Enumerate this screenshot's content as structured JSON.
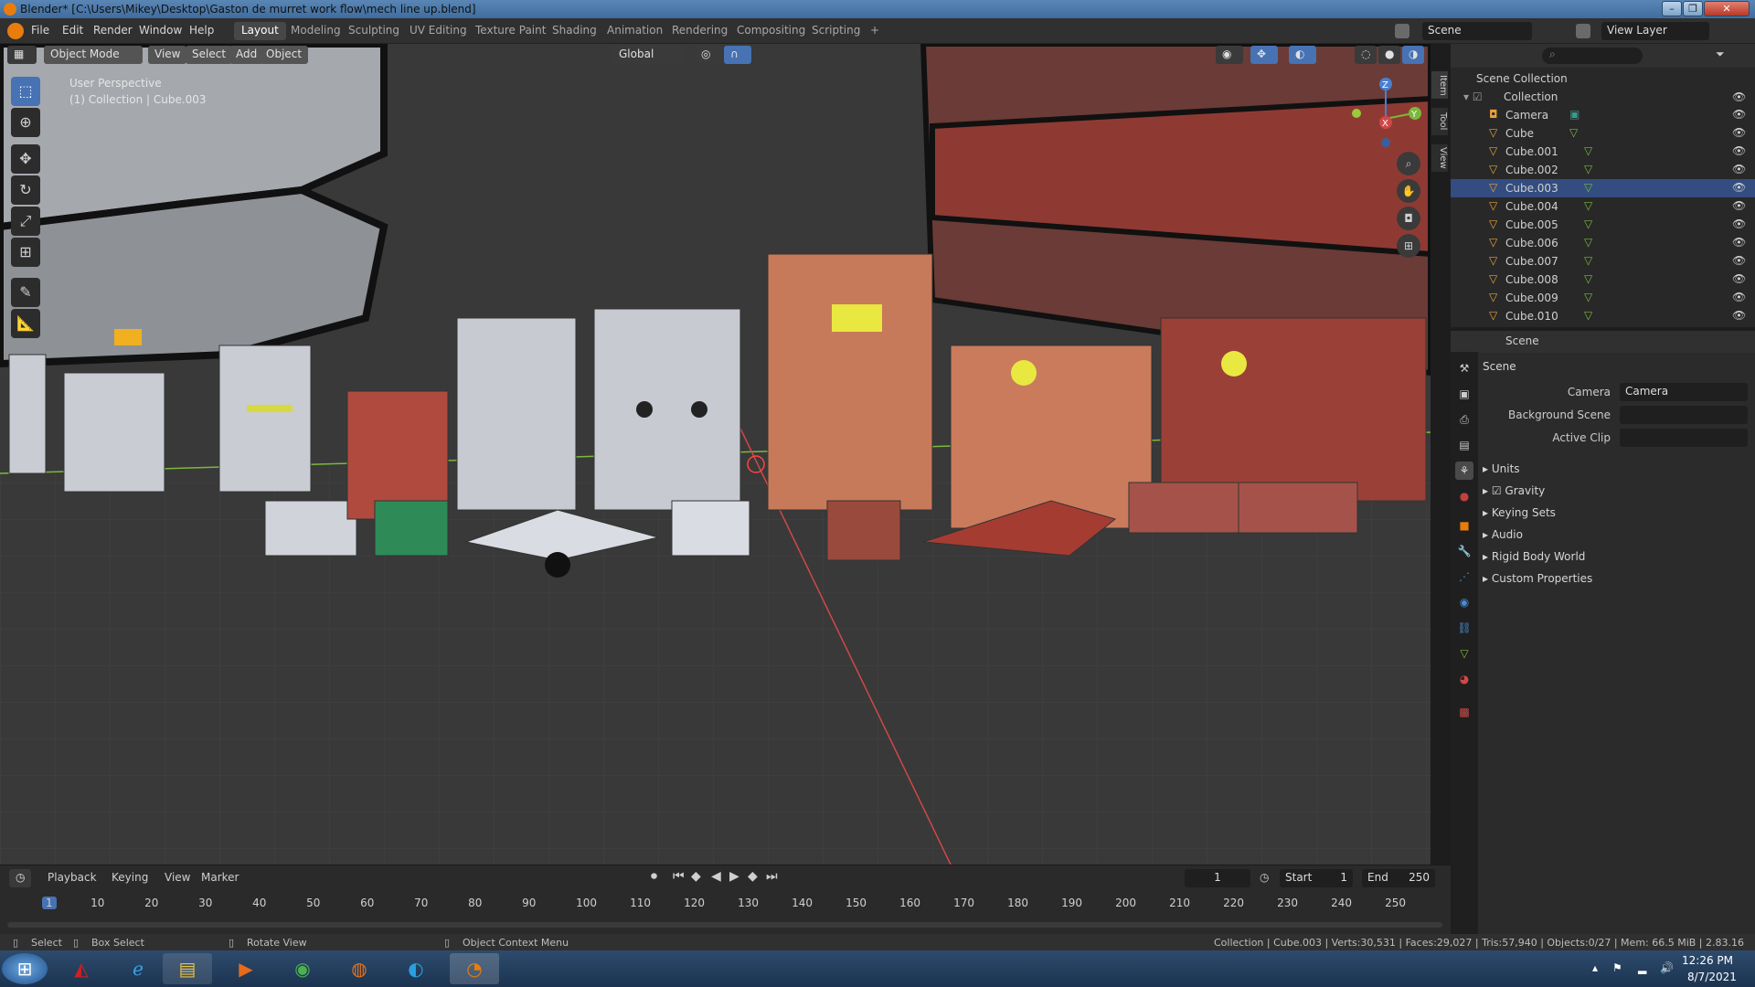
{
  "window": {
    "title": "Blender* [C:\\Users\\Mikey\\Desktop\\Gaston de murret work flow\\mech line up.blend]",
    "minimize": "–",
    "maximize": "❐",
    "close": "✕"
  },
  "menus": [
    "File",
    "Edit",
    "Render",
    "Window",
    "Help"
  ],
  "workspaces": [
    "Layout",
    "Modeling",
    "Sculpting",
    "UV Editing",
    "Texture Paint",
    "Shading",
    "Animation",
    "Rendering",
    "Compositing",
    "Scripting",
    "+"
  ],
  "scene_field": "Scene",
  "view_layer_field": "View Layer",
  "viewport": {
    "mode": "Object Mode",
    "view": "View",
    "select": "Select",
    "add": "Add",
    "object": "Object",
    "orientation": "Global",
    "overlay_line1": "User Perspective",
    "overlay_line2": "(1) Collection | Cube.003",
    "side_tabs": [
      "Item",
      "Tool",
      "View"
    ],
    "gizmo": {
      "x": "X",
      "y": "Y",
      "z": "Z"
    }
  },
  "outliner": {
    "root": "Scene Collection",
    "collection": "Collection",
    "items": [
      "Camera",
      "Cube",
      "Cube.001",
      "Cube.002",
      "Cube.003",
      "Cube.004",
      "Cube.005",
      "Cube.006",
      "Cube.007",
      "Cube.008",
      "Cube.009",
      "Cube.010"
    ],
    "selected": "Cube.003"
  },
  "properties": {
    "header": "Scene",
    "panel": "Scene",
    "camera_label": "Camera",
    "camera_value": "Camera",
    "bg_scene_label": "Background Scene",
    "active_clip_label": "Active Clip",
    "sections": [
      "Units",
      "Gravity",
      "Keying Sets",
      "Audio",
      "Rigid Body World",
      "Custom Properties"
    ]
  },
  "timeline": {
    "playback": "Playback",
    "keying": "Keying",
    "view": "View",
    "marker": "Marker",
    "current": "1",
    "start_label": "Start",
    "start": "1",
    "end_label": "End",
    "end": "250",
    "ticks": [
      "1",
      "10",
      "20",
      "30",
      "40",
      "50",
      "60",
      "70",
      "80",
      "90",
      "100",
      "110",
      "120",
      "130",
      "140",
      "150",
      "160",
      "170",
      "180",
      "190",
      "200",
      "210",
      "220",
      "230",
      "240",
      "250"
    ]
  },
  "statusbar": {
    "select": "Select",
    "box_select": "Box Select",
    "rotate": "Rotate View",
    "context": "Object Context Menu",
    "stats": "Collection | Cube.003 | Verts:30,531 | Faces:29,027 | Tris:57,940 | Objects:0/27 | Mem: 66.5 MiB | 2.83.16"
  },
  "taskbar": {
    "time": "12:26 PM",
    "date": "8/7/2021"
  },
  "colors": {
    "accent": "#4772b3",
    "selection": "#334d80",
    "viewport_bg": "#3b3b3b",
    "red_axis": "#d04848",
    "green_axis": "#7ab93c"
  }
}
